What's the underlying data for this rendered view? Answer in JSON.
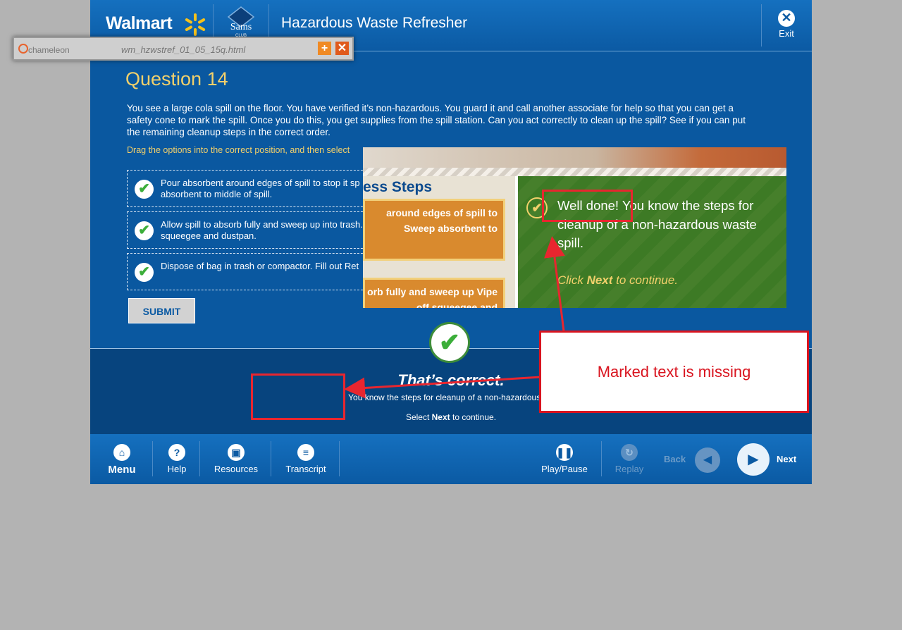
{
  "header": {
    "walmart_logo": "Walmart",
    "sams_logo": "Sams",
    "sams_sub": "CLUB",
    "course_title": "Hazardous Waste Refresher",
    "exit_label": "Exit"
  },
  "popup": {
    "brand": "chameleon",
    "filename": "wm_hzwstref_01_05_15q.html"
  },
  "question": {
    "title": "Question 14",
    "stem": "You see a large cola spill on the floor.  You have verified it’s non-hazardous.  You guard it and call another associate for help so that you can get a safety cone to mark the spill.  Once you do this, you get supplies from the spill station.  Can you act correctly to clean up the spill?  See if you can put the remaining cleanup steps in the correct order.",
    "instruction": "Drag the options into the correct position, and then select",
    "options": [
      {
        "text": "Pour absorbent around edges of spill to stop it sp absorbent to middle of spill."
      },
      {
        "text": "Allow spill to absorb fully and sweep up into trash.  squeegee and dustpan."
      },
      {
        "text": "Dispose of bag in trash or compactor.  Fill out Ret"
      }
    ],
    "submit_label": "SUBMIT"
  },
  "feedback": {
    "title": "That’s correct.",
    "text": "You know the steps for cleanup of a non-hazardous wa",
    "next_prefix": "Select ",
    "next_bold": "Next",
    "next_suffix": " to continue."
  },
  "reference_screenshot": {
    "left_title": "ess Steps",
    "card1": "around edges of spill to  Sweep absorbent to",
    "card2": "orb fully and sweep up Vipe off squeegee and",
    "message": "Well done!  You know the steps for cleanup of a non-hazardous waste spill.",
    "click_prefix": "Click ",
    "click_bold": "Next",
    "click_suffix": " to continue."
  },
  "annotation": {
    "callout": "Marked text is missing"
  },
  "bottom_bar": {
    "menu": "Menu",
    "help": "Help",
    "resources": "Resources",
    "transcript": "Transcript",
    "play_pause": "Play/Pause",
    "replay": "Replay",
    "back": "Back",
    "next": "Next"
  },
  "colors": {
    "page_background": "#b3b3b3",
    "app_blue": "#0a58a0",
    "feedback_blue": "#07447e",
    "accent_yellow": "#f2d06b",
    "check_green": "#3cae3a",
    "annotation_red": "#e8262f"
  },
  "icons": {
    "walmart_spark": "spark-icon",
    "exit": "close-circle-icon",
    "option_check": "check-icon",
    "feedback_check": "check-circle-icon",
    "menu": "home-icon",
    "help": "question-icon",
    "resources": "document-icon",
    "transcript": "list-icon",
    "play_pause": "pause-icon",
    "replay": "replay-icon",
    "back": "arrow-left-icon",
    "next": "arrow-right-icon",
    "popup_expand": "plus-icon",
    "popup_close": "close-icon"
  }
}
